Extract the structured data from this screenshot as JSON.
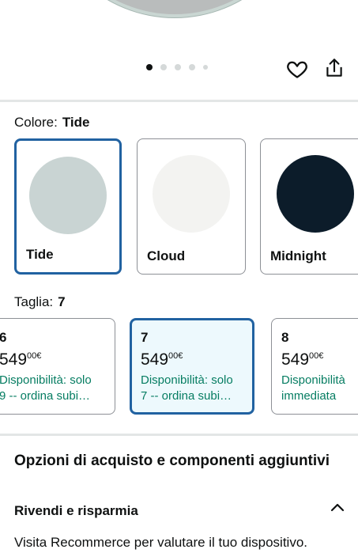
{
  "carousel": {
    "dots": 5,
    "active_index": 0
  },
  "color": {
    "label": "Colore:",
    "selected": "Tide",
    "options": [
      {
        "name": "Tide",
        "hex": "#c9d4d3",
        "selected": true
      },
      {
        "name": "Cloud",
        "hex": "#f3f3f1",
        "selected": false
      },
      {
        "name": "Midnight",
        "hex": "#0c1c2a",
        "selected": false
      }
    ]
  },
  "size": {
    "label": "Taglia:",
    "selected": "7",
    "options": [
      {
        "size": "6",
        "price_int": "549",
        "price_dec": "00",
        "currency": "€",
        "avail_1": "Disponibilità: solo",
        "avail_2": "9 -- ordina subi…"
      },
      {
        "size": "7",
        "price_int": "549",
        "price_dec": "00",
        "currency": "€",
        "avail_1": "Disponibilità: solo",
        "avail_2": "7 -- ordina subi…"
      },
      {
        "size": "8",
        "price_int": "549",
        "price_dec": "00",
        "currency": "€",
        "avail_1": "Disponibilità",
        "avail_2": "immediata"
      }
    ]
  },
  "purchase": {
    "title": "Opzioni di acquisto e componenti aggiuntivi",
    "resell_title": "Rivendi e risparmia",
    "resell_text": "Visita Recommerce per valutare il tuo dispositivo."
  },
  "colors": {
    "accent": "#2162a1",
    "available": "#067d62",
    "selected_bg": "#edf9fd"
  }
}
